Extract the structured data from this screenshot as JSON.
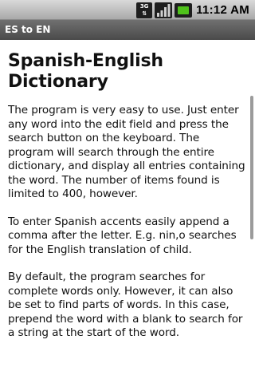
{
  "status_bar": {
    "network": [
      "3G",
      ""
    ],
    "time": "11:12 AM",
    "icons": [
      "3g-icon",
      "signal-icon",
      "battery-icon"
    ]
  },
  "title_bar": {
    "title": "ES to EN"
  },
  "content": {
    "heading": "Spanish-English Dictionary",
    "paragraphs": [
      "The program is very easy to use. Just enter any word into the edit field and press the search button on the keyboard. The program will search through the entire dictionary, and display all entries containing the word. The number of items found is limited to 400, however.",
      "To enter Spanish accents easily append a comma after the letter. E.g. nin,o searches for the English translation of child.",
      "By default, the program searches for complete words only. However, it can also be set to find parts of words. In this case, prepend the word with a blank to search for a string at the start of the word."
    ]
  },
  "colors": {
    "title_bar": "#5c5c5c",
    "battery": "#4fc21b"
  }
}
